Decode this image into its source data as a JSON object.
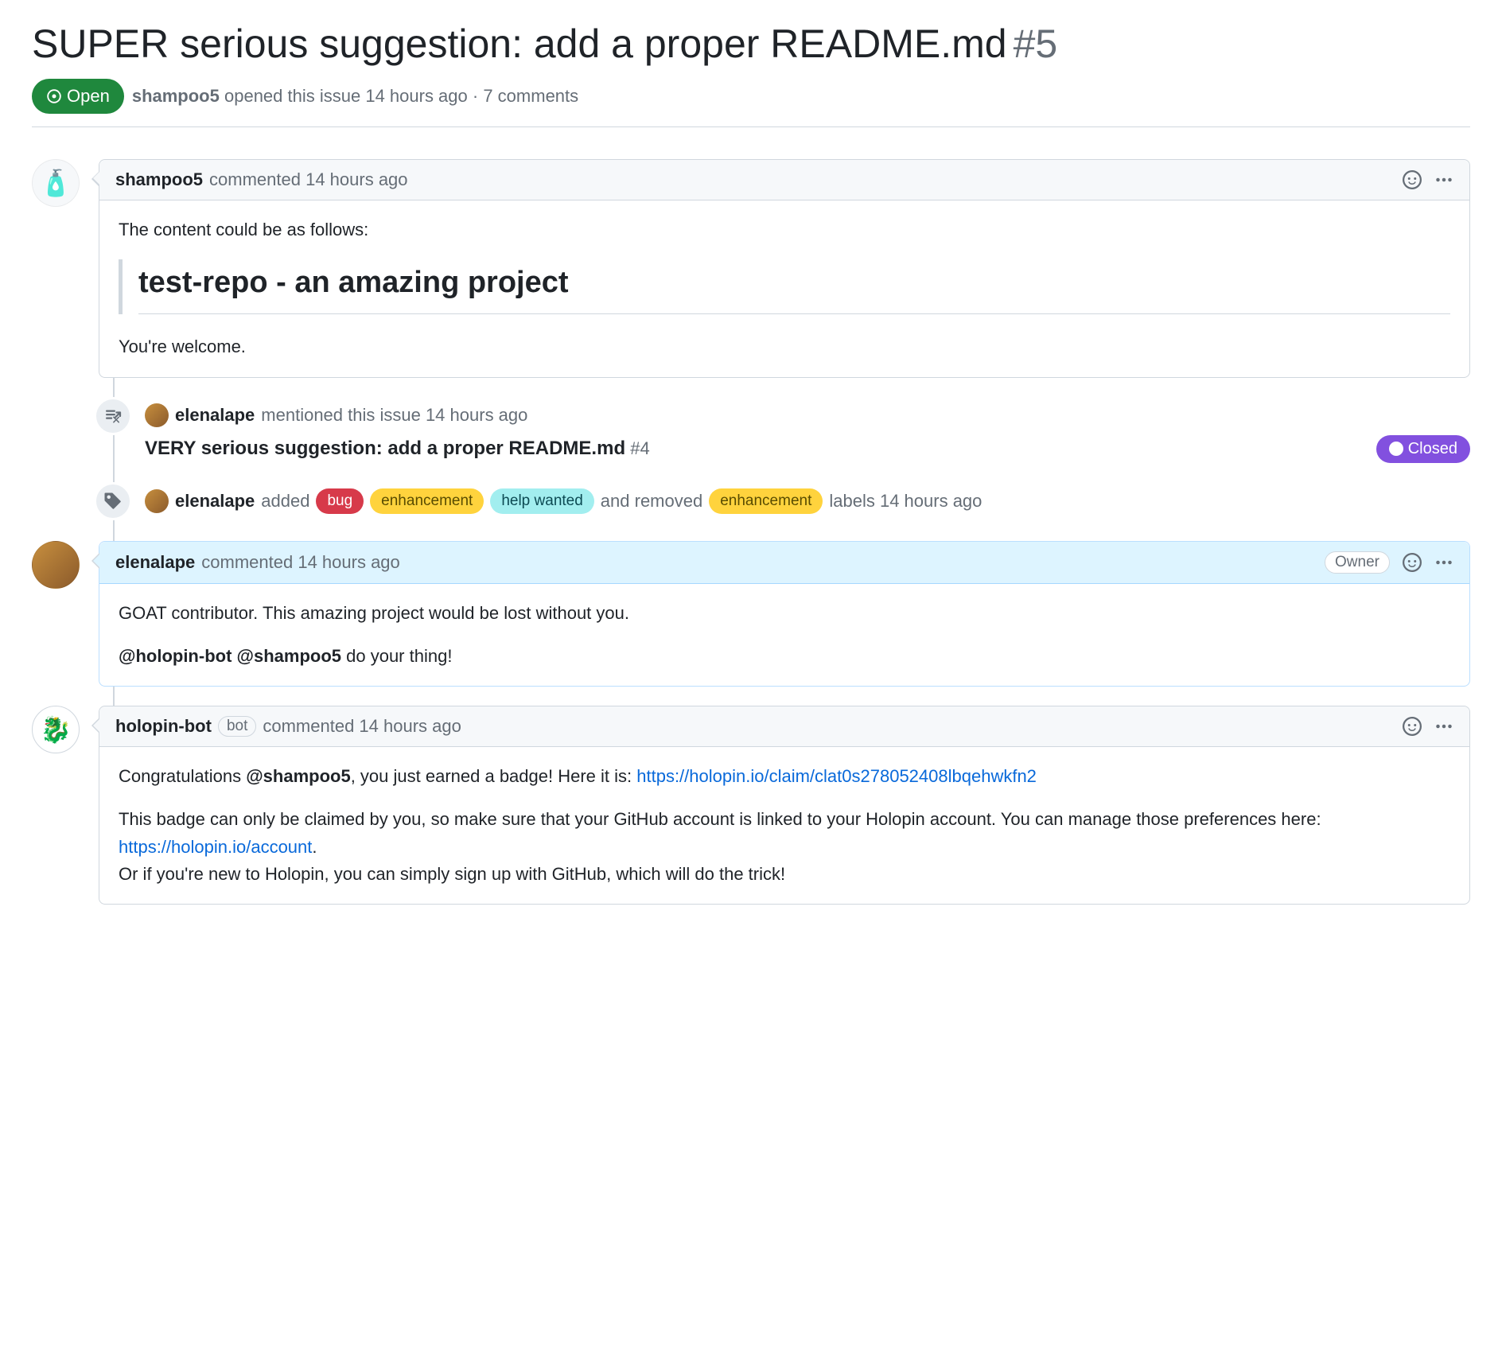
{
  "issue": {
    "title": "SUPER serious suggestion: add a proper README.md",
    "number": "#5",
    "state": "Open",
    "opener": "shampoo5",
    "opened_text": "opened this issue 14 hours ago",
    "comment_count": "7 comments"
  },
  "comments": [
    {
      "author": "shampoo5",
      "action": "commented 14 hours ago",
      "intro": "The content could be as follows:",
      "quote_heading": "test-repo - an amazing project",
      "footer": "You're welcome."
    },
    {
      "author": "elenalape",
      "action": "commented 14 hours ago",
      "owner_label": "Owner",
      "p1": "GOAT contributor. This amazing project would be lost without you.",
      "m1": "@holopin-bot",
      "m2": "@shampoo5",
      "p2_tail": " do your thing!"
    },
    {
      "author": "holopin-bot",
      "bot_label": "bot",
      "action": "commented 14 hours ago",
      "p1_a": "Congratulations ",
      "p1_m": "@shampoo5",
      "p1_b": ", you just earned a badge! Here it is: ",
      "link1": "https://holopin.io/claim/clat0s278052408lbqehwkfn2",
      "p2": "This badge can only be claimed by you, so make sure that your GitHub account is linked to your Holopin account. You can manage those preferences here: ",
      "link2": "https://holopin.io/account",
      "dot": ".",
      "p3": "Or if you're new to Holopin, you can simply sign up with GitHub, which will do the trick!"
    }
  ],
  "events": {
    "mention": {
      "user": "elenalape",
      "action": "mentioned this issue 14 hours ago",
      "ref_title": "VERY serious suggestion: add a proper README.md",
      "ref_number": "#4",
      "ref_state": "Closed"
    },
    "labels": {
      "user": "elenalape",
      "added_word": "added",
      "removed_word": "and removed",
      "tail": "labels 14 hours ago",
      "added": [
        "bug",
        "enhancement",
        "help wanted"
      ],
      "removed": [
        "enhancement"
      ]
    }
  }
}
